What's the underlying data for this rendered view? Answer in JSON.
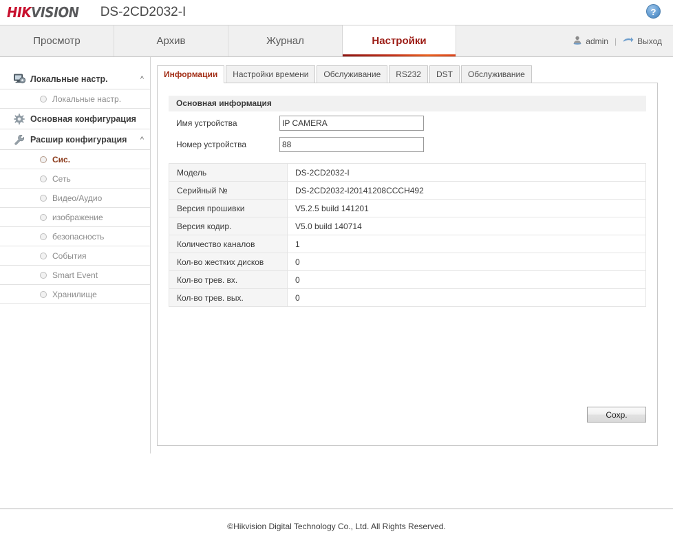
{
  "header": {
    "logo_hik": "HIK",
    "logo_vision": "VISION",
    "model_title": "DS-2CD2032-I",
    "help_glyph": "?"
  },
  "nav": {
    "tabs": [
      {
        "label": "Просмотр",
        "active": false
      },
      {
        "label": "Архив",
        "active": false
      },
      {
        "label": "Журнал",
        "active": false
      },
      {
        "label": "Настройки",
        "active": true
      }
    ],
    "user_name": "admin",
    "separator": "|",
    "logout_label": "Выход"
  },
  "sidebar": {
    "groups": [
      {
        "label": "Локальные настр.",
        "icon": "monitor-gear-icon",
        "caret": "^",
        "items": [
          {
            "label": "Локальные настр.",
            "active": false
          }
        ]
      },
      {
        "label": "Основная конфигурация",
        "icon": "gear-icon",
        "caret": "",
        "items": []
      },
      {
        "label": "Расшир конфигурация",
        "icon": "wrench-icon",
        "caret": "^",
        "items": [
          {
            "label": "Сис.",
            "active": true
          },
          {
            "label": "Сеть",
            "active": false
          },
          {
            "label": "Видео/Аудио",
            "active": false
          },
          {
            "label": "изображение",
            "active": false
          },
          {
            "label": "безопасность",
            "active": false
          },
          {
            "label": "События",
            "active": false
          },
          {
            "label": "Smart Event",
            "active": false
          },
          {
            "label": "Хранилище",
            "active": false
          }
        ]
      }
    ]
  },
  "content": {
    "sub_tabs": [
      {
        "label": "Информации",
        "active": true
      },
      {
        "label": "Настройки времени",
        "active": false
      },
      {
        "label": "Обслуживание",
        "active": false
      },
      {
        "label": "RS232",
        "active": false
      },
      {
        "label": "DST",
        "active": false
      },
      {
        "label": "Обслуживание",
        "active": false
      }
    ],
    "section_title": "Основная информация",
    "fields": [
      {
        "label": "Имя устройства",
        "value": "IP CAMERA",
        "placeholder": ""
      },
      {
        "label": "Номер устройства",
        "value": "88",
        "placeholder": ""
      }
    ],
    "info_rows": [
      {
        "key": "Модель",
        "value": "DS-2CD2032-I"
      },
      {
        "key": "Серийный №",
        "value": "DS-2CD2032-I20141208CCCH492"
      },
      {
        "key": "Версия прошивки",
        "value": "V5.2.5 build 141201"
      },
      {
        "key": "Версия кодир.",
        "value": "V5.0 build 140714"
      },
      {
        "key": "Количество каналов",
        "value": "1"
      },
      {
        "key": "Кол-во жестких дисков",
        "value": "0"
      },
      {
        "key": "Кол-во трев. вх.",
        "value": "0"
      },
      {
        "key": "Кол-во трев. вых.",
        "value": "0"
      }
    ],
    "save_label": "Сохр."
  },
  "footer": {
    "copyright": "©Hikvision Digital Technology Co., Ltd. All Rights Reserved."
  },
  "colors": {
    "brand_red": "#c8102e",
    "accent_red": "#9b1b14",
    "active_item": "#8b3a1a",
    "help_blue": "#3f7cb8"
  }
}
